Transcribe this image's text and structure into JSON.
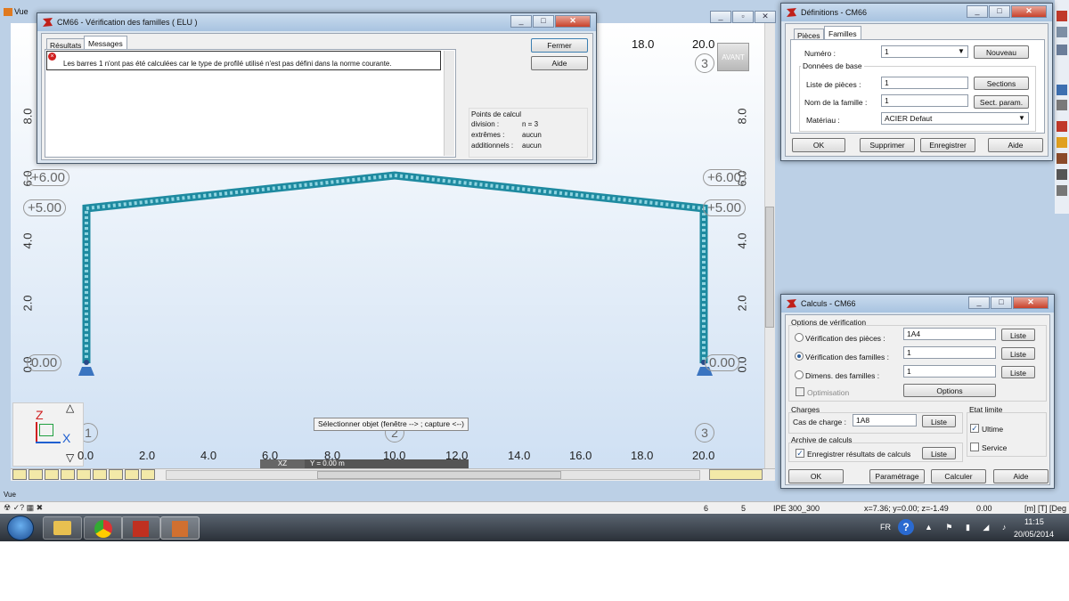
{
  "app": {
    "title": "Vue",
    "statusbar_label": "Vue",
    "bottom_left_icons": "☢ ✓? ▦ ✖"
  },
  "canvas": {
    "y_ticks": [
      "8.0",
      "6.0",
      "4.0",
      "2.0",
      "0.0"
    ],
    "x_ticks": [
      "0.0",
      "2.0",
      "4.0",
      "6.0",
      "8.0",
      "10.0",
      "12.0",
      "14.0",
      "16.0",
      "18.0",
      "20.0"
    ],
    "top_right_tick_18": "18.0",
    "top_right_tick_20": "20.0",
    "elevation_labels_left": [
      "+6.00",
      "+5.00",
      "0.00"
    ],
    "elevation_labels_right": [
      "+6.00",
      "+5.00",
      "0.00"
    ],
    "node_labels": [
      "1",
      "2",
      "3"
    ],
    "view_cube": "AVANT",
    "hint": "Sélectionner objet (fenêtre --> ; capture <--)",
    "plane_label": "XZ",
    "coord_label": "Y = 0.00 m",
    "axis_x": "X",
    "axis_z": "Z"
  },
  "verif_window": {
    "title": "CM66 - Vérification des familles ( ELU )",
    "tabs": [
      "Résultats",
      "Messages"
    ],
    "message": "Les barres  1   n'ont pas été calculées car le type de profilé utilisé n'est pas défini dans la norme courante.",
    "close_label": "Fermer",
    "help_label": "Aide",
    "points_title": "Points de calcul",
    "points": [
      {
        "label": "division :",
        "value": "n = 3"
      },
      {
        "label": "extrêmes :",
        "value": "aucun"
      },
      {
        "label": "additionnels :",
        "value": "aucun"
      }
    ]
  },
  "definitions_window": {
    "title": "Définitions - CM66",
    "tabs": [
      "Pièces",
      "Familles"
    ],
    "numero_label": "Numéro :",
    "numero_value": "1",
    "nouveau_label": "Nouveau",
    "base_group": "Données de base",
    "pieces_label": "Liste de pièces :",
    "pieces_value": "1",
    "sections_label": "Sections",
    "nom_label": "Nom de la famille :",
    "nom_value": "1",
    "sect_param_label": "Sect. param.",
    "materiau_label": "Matériau :",
    "materiau_value": "ACIER  Defaut",
    "ok_label": "OK",
    "supprimer_label": "Supprimer",
    "enregistrer_label": "Enregistrer",
    "aide_label": "Aide"
  },
  "calculs_window": {
    "title": "Calculs - CM66",
    "options_group": "Options de vérification",
    "opt1_label": "Vérification des pièces :",
    "opt1_value": "1A4",
    "opt2_label": "Vérification des familles :",
    "opt2_value": "1",
    "opt3_label": "Dimens. des familles :",
    "opt3_value": "1",
    "liste_label": "Liste",
    "optimisation_label": "Optimisation",
    "options_button": "Options",
    "charges_group": "Charges",
    "cas_label": "Cas de charge :",
    "cas_value": "1A8",
    "etat_group": "Etat limite",
    "ultime_label": "Ultime",
    "service_label": "Service",
    "archive_group": "Archive de calculs",
    "archive_label": "Enregistrer résultats de calculs",
    "ok_label": "OK",
    "parametrage_label": "Paramétrage",
    "calculer_label": "Calculer",
    "aide_label": "Aide"
  },
  "status": {
    "count1": "6",
    "count2": "5",
    "section": "IPE 300_300",
    "coords": "x=7.36; y=0.00; z=-1.49",
    "value": "0.00",
    "units": "[m] [T] [Deg"
  },
  "taskbar": {
    "lang": "FR",
    "time": "11:15",
    "date": "20/05/2014"
  }
}
